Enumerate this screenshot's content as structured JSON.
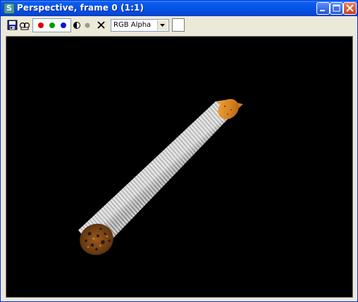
{
  "window": {
    "title": "Perspective, frame 0 (1:1)",
    "app_icon_letter": "S"
  },
  "toolbar": {
    "save_icon": "save-icon",
    "clone_icon": "clone-icon",
    "channels": [
      {
        "name": "red",
        "color": "#e00000"
      },
      {
        "name": "green",
        "color": "#009a00"
      },
      {
        "name": "blue",
        "color": "#0018d8"
      }
    ],
    "mono_icon": "mono-icon",
    "clear_icon": "clear-icon",
    "channel_select": {
      "value": "RGB Alpha"
    },
    "swatch_color": "#ffffff"
  },
  "viewport": {
    "background": "#000000"
  }
}
